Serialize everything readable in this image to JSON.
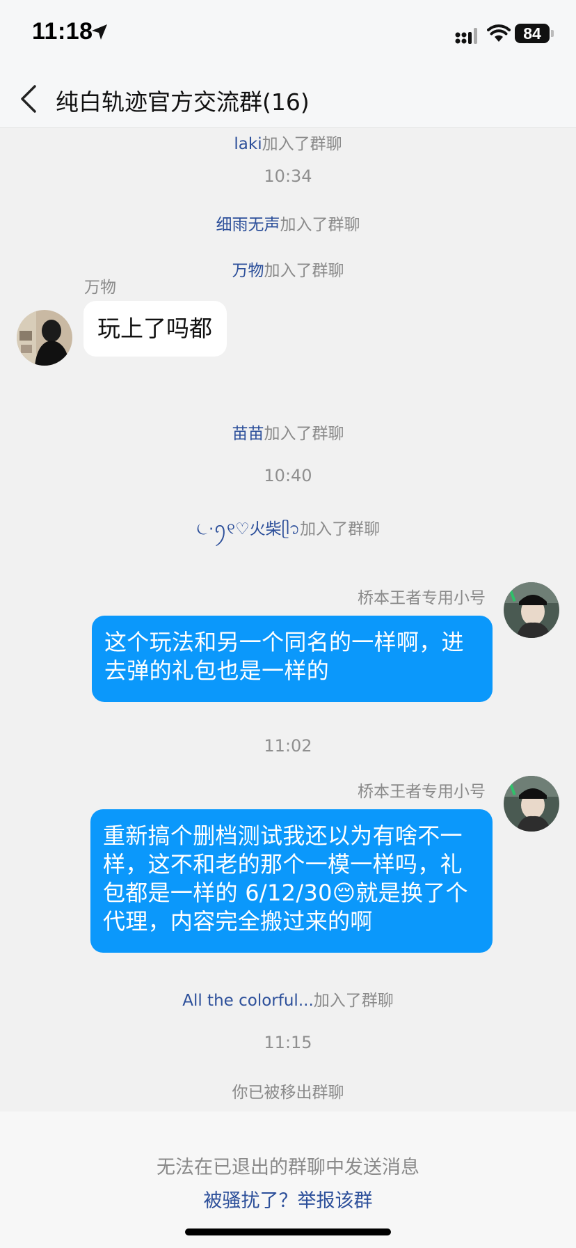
{
  "status_bar": {
    "time": "11:18",
    "battery": "84"
  },
  "nav": {
    "title": "纯白轨迹官方交流群(16)"
  },
  "chat": {
    "joined_suffix": "加入了群聊",
    "sys1_name": "laki",
    "time1": "10:34",
    "sys2_name": "细雨无声",
    "sys3_name": "万物",
    "msg1_sender": "万物",
    "msg1_text": "玩上了吗都",
    "sys4_name": "苗苗",
    "time2": "10:40",
    "sys5_name": "⏾·ꪆ୧♡火柴ᥫ᭡",
    "msg2_sender": "桥本王者专用小号",
    "msg2_text": "这个玩法和另一个同名的一样啊，进去弹的礼包也是一样的",
    "time3": "11:02",
    "msg3_sender": "桥本王者专用小号",
    "msg3_text": "重新搞个删档测试我还以为有啥不一样，这不和老的那个一模一样吗，礼包都是一样的 6/12/30😔就是换了个代理，内容完全搬过来的啊",
    "sys6_name": "All the colorful...",
    "time4": "11:15",
    "removed_notice": "你已被移出群聊"
  },
  "footer": {
    "note": "无法在已退出的群聊中发送消息",
    "report_link": "被骚扰了？举报该群"
  },
  "colors": {
    "accent": "#0b98fb",
    "link": "#2c4f9a",
    "background": "#f1f1f1"
  }
}
